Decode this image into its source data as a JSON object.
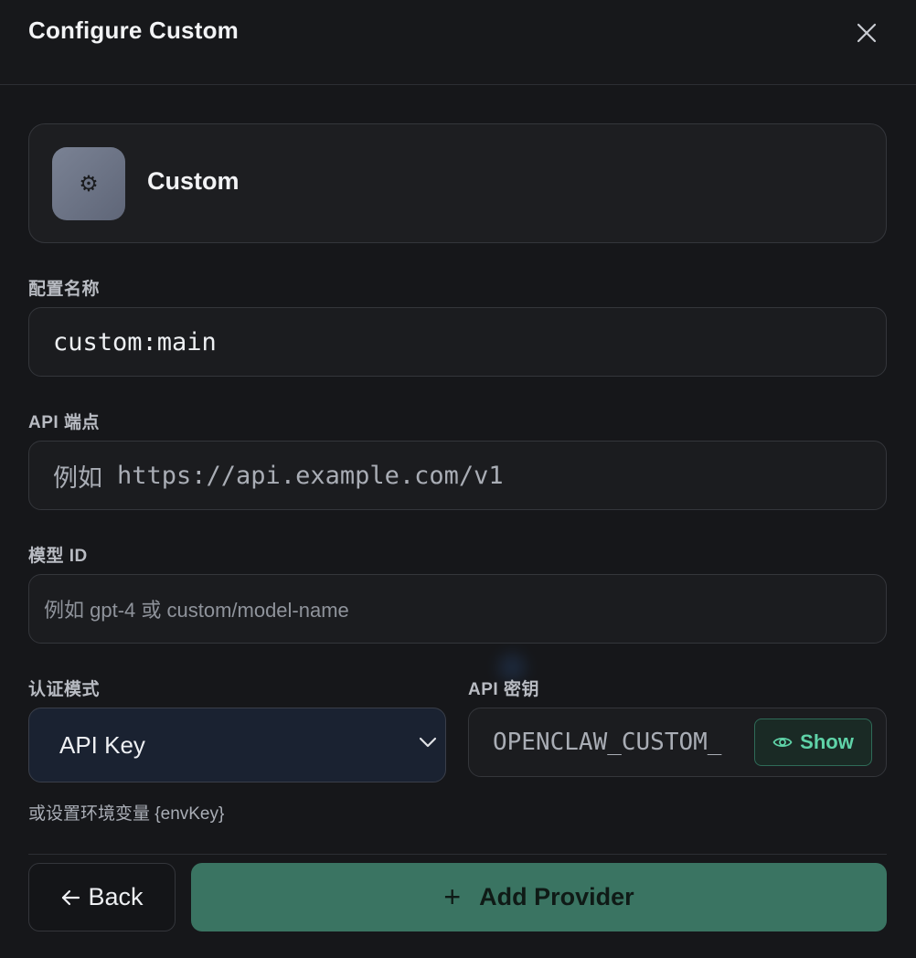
{
  "header": {
    "title": "Configure Custom"
  },
  "provider": {
    "icon": "gear-icon",
    "name": "Custom"
  },
  "fields": {
    "config_name": {
      "label": "配置名称",
      "value": "custom:main"
    },
    "api_endpoint": {
      "label": "API 端点",
      "placeholder_prefix": "例如",
      "placeholder_url": "https://api.example.com/v1"
    },
    "model_id": {
      "label": "模型 ID",
      "placeholder": "例如 gpt-4 或 custom/model-name"
    },
    "auth_mode": {
      "label": "认证模式",
      "selected": "API Key"
    },
    "api_key": {
      "label": "API 密钥",
      "value": "OPENCLAW_CUSTOM_",
      "show_label": "Show"
    }
  },
  "hint": "或设置环境变量 {envKey}",
  "footer": {
    "back_label": "Back",
    "add_label": "Add Provider"
  },
  "colors": {
    "accent": "#3a7462",
    "show_text": "#5fd3a8",
    "background": "#16171a"
  }
}
